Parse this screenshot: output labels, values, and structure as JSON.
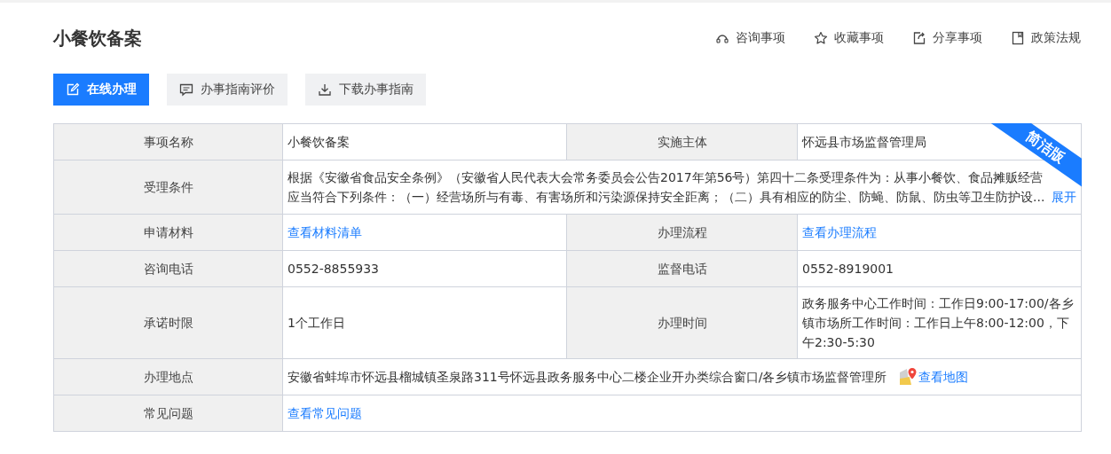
{
  "title": "小餐饮备案",
  "header_actions": [
    {
      "kind": "headset",
      "label": "咨询事项"
    },
    {
      "kind": "star",
      "label": "收藏事项"
    },
    {
      "kind": "share",
      "label": "分享事项"
    },
    {
      "kind": "book",
      "label": "政策法规"
    }
  ],
  "buttons": [
    {
      "kind": "edit",
      "label": "在线办理",
      "primary": true
    },
    {
      "kind": "comment",
      "label": "办事指南评价",
      "primary": false
    },
    {
      "kind": "download",
      "label": "下载办事指南",
      "primary": false
    }
  ],
  "badge": "简洁版",
  "rows": [
    {
      "cells": [
        {
          "label": "事项名称",
          "kind": "text",
          "value": "小餐饮备案"
        },
        {
          "label": "实施主体",
          "kind": "text",
          "value": "怀远县市场监督管理局"
        }
      ]
    },
    {
      "cells": [
        {
          "label": "受理条件",
          "kind": "clamped",
          "value": "根据《安徽省食品安全条例》（安徽省人民代表大会常务委员会公告2017年第56号）第四十二条受理条件为：从事小餐饮、食品摊贩经营应当符合下列条件：（一）经营场所与有毒、有害场所和污染源保持安全距离；（二）具有相应的防尘、防蝇、防鼠、防虫等卫生防护设...",
          "more": "展开"
        }
      ]
    },
    {
      "cells": [
        {
          "label": "申请材料",
          "kind": "link",
          "value": "查看材料清单"
        },
        {
          "label": "办理流程",
          "kind": "link",
          "value": "查看办理流程"
        }
      ]
    },
    {
      "cells": [
        {
          "label": "咨询电话",
          "kind": "text",
          "value": "0552-8855933"
        },
        {
          "label": "监督电话",
          "kind": "text",
          "value": "0552-8919001"
        }
      ]
    },
    {
      "cells": [
        {
          "label": "承诺时限",
          "kind": "text",
          "value": "1个工作日"
        },
        {
          "label": "办理时间",
          "kind": "text",
          "value": "政务服务中心工作时间：工作日9:00-17:00/各乡镇市场所工作时间：工作日上午8:00-12:00，下午2:30-5:30"
        }
      ]
    },
    {
      "cells": [
        {
          "label": "办理地点",
          "kind": "address",
          "value": "安徽省蚌埠市怀远县榴城镇圣泉路311号怀远县政务服务中心二楼企业开办类综合窗口/各乡镇市场监督管理所",
          "more": "查看地图"
        }
      ]
    },
    {
      "cells": [
        {
          "label": "常见问题",
          "kind": "link",
          "value": "查看常见问题"
        }
      ]
    }
  ]
}
